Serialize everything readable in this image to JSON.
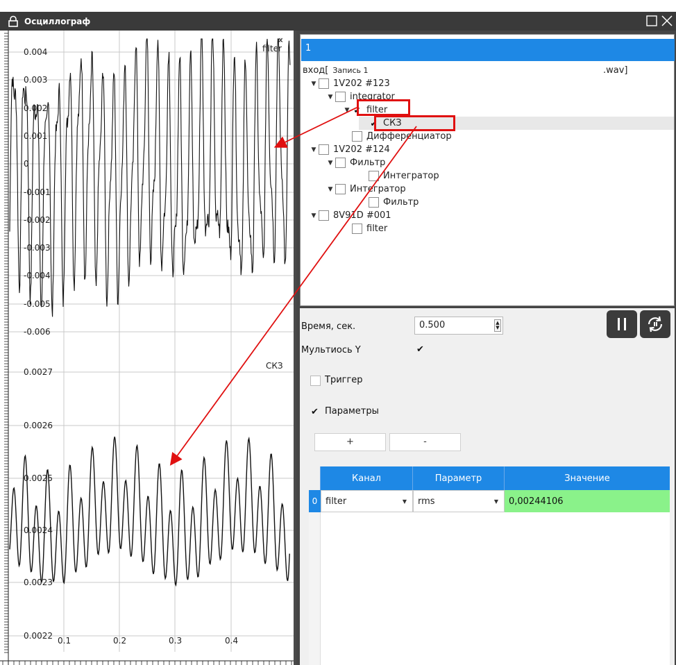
{
  "window": {
    "title": "Осциллограф"
  },
  "plot": {
    "top_label": "filter",
    "bottom_label": "СКЗ",
    "top_ticks": [
      "0.004",
      "0.003",
      "0.002",
      "0.001",
      "0",
      "-0.001",
      "-0.002",
      "-0.003",
      "-0.004",
      "-0.005",
      "-0.006"
    ],
    "bottom_ticks": [
      "0.0027",
      "0.0026",
      "0.0025",
      "0.0024",
      "0.0023",
      "0.0022"
    ],
    "x_ticks": [
      "0.1",
      "0.2",
      "0.3",
      "0.4"
    ],
    "collapse_glyph": "«"
  },
  "tree": {
    "header": "1",
    "root_prefix": "вход[",
    "root_name": "Запись 1",
    "root_suffix": ".wav]",
    "items": [
      {
        "label": "1V202 #123",
        "checked": false,
        "expander": "▼"
      },
      {
        "label": "integrator",
        "checked": false,
        "expander": "▼"
      },
      {
        "label": "filter",
        "checked": true,
        "expander": "▼"
      },
      {
        "label": "СКЗ",
        "checked": true,
        "expander": ""
      },
      {
        "label": "Дифференциатор",
        "checked": false,
        "expander": ""
      },
      {
        "label": "1V202 #124",
        "checked": false,
        "expander": "▼"
      },
      {
        "label": "Фильтр",
        "checked": false,
        "expander": "▼"
      },
      {
        "label": "Интегратор",
        "checked": false,
        "expander": ""
      },
      {
        "label": "Интегратор",
        "checked": false,
        "expander": "▼"
      },
      {
        "label": "Фильтр",
        "checked": false,
        "expander": ""
      },
      {
        "label": "8V91D #001",
        "checked": false,
        "expander": "▼"
      },
      {
        "label": "filter",
        "checked": false,
        "expander": ""
      }
    ]
  },
  "controls": {
    "time_label": "Время, сек.",
    "time_value": "0.500",
    "multiaxis_label": "Мультиось Y",
    "multiaxis_checked": "✔",
    "trigger_label": "Триггер",
    "params_label": "Параметры",
    "params_checked": "✔",
    "add_label": "+",
    "remove_label": "-"
  },
  "grid": {
    "columns": [
      "Канал",
      "Параметр",
      "Значение"
    ],
    "rows": [
      {
        "index": "0",
        "channel": "filter",
        "parameter": "rms",
        "value": "0,00244106"
      }
    ]
  },
  "colors": {
    "accent": "#1e88e5",
    "highlight": "#e01010",
    "value_bg": "#8af28a",
    "dark": "#454545"
  }
}
